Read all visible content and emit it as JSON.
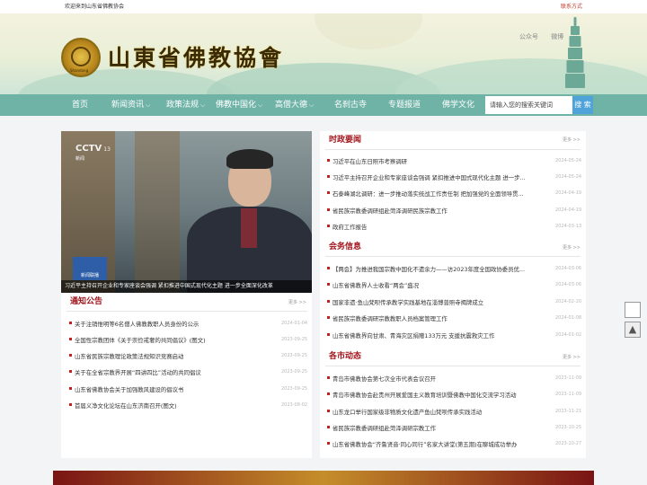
{
  "topbar": {
    "welcome": "欢迎来到山东省佛教协会",
    "contact": "联系方式"
  },
  "header": {
    "title": "山東省佛教協會",
    "logo_text": "Shandong",
    "links": [
      "公众号",
      "微博"
    ]
  },
  "nav": {
    "items": [
      "首页",
      "新闻资讯",
      "政策法规",
      "佛教中国化",
      "高僧大德",
      "名刹古寺",
      "专题报道",
      "佛学文化"
    ],
    "dropdowns": [
      false,
      true,
      true,
      true,
      true,
      false,
      false,
      false
    ]
  },
  "search": {
    "placeholder": "请输入您的搜索关键词",
    "button": "搜 索"
  },
  "slider": {
    "channel": "CCTV",
    "channel_num": "13",
    "channel_sub": "新闻",
    "badge": "新闻联播",
    "caption": "习近平主持召开企业和专家座谈会强调 紧扣推进中国式现代化主题 进一步全面深化改革"
  },
  "notice": {
    "title": "通知公告",
    "more": "更多 >>",
    "items": [
      {
        "text": "关于注销惟明等6名僧人佛教教职人员身份的公示",
        "date": "2024-01-04"
      },
      {
        "text": "全国性宗教团体《关于崇俭戒奢的共同倡议》(图文)",
        "date": "2023-09-25"
      },
      {
        "text": "山东省民族宗教理论政策法规知识竞赛启动",
        "date": "2023-09-25"
      },
      {
        "text": "关于在全省宗教界开展“四讲四比”活动的共同倡议",
        "date": "2023-09-25"
      },
      {
        "text": "山东省佛教协会关于加强教风建设的倡议书",
        "date": "2023-09-25"
      },
      {
        "text": "首届义净文化论坛在山东济南召开(图文)",
        "date": "2023-08-02"
      }
    ]
  },
  "politics": {
    "title": "时政要闻",
    "more": "更多 >>",
    "items": [
      {
        "text": "习近平在山东日照市考察调研",
        "date": "2024-05-24"
      },
      {
        "text": "习近平主持召开企业和专家座谈会强调 紧扣推进中国式现代化主题 进一步...",
        "date": "2024-05-24"
      },
      {
        "text": "石泰峰湖北调研：进一步推动落实统战工作责任制 把加强党的全面领导贯...",
        "date": "2024-04-19"
      },
      {
        "text": "省民族宗教委调研组赴菏泽调研民族宗教工作",
        "date": "2024-04-19"
      },
      {
        "text": "政府工作报告",
        "date": "2024-03-13"
      }
    ]
  },
  "association": {
    "title": "会务信息",
    "more": "更多 >>",
    "items": [
      {
        "text": "【两会】为推进我国宗教中国化不遗余力——访2023年度全国政协委员优...",
        "date": "2024-03-06"
      },
      {
        "text": "山东省佛教界人士收看“两会”盛况",
        "date": "2024-03-06"
      },
      {
        "text": "国家非遗·鱼山梵呗传承教学实践基地在淄博普照寺揭牌成立",
        "date": "2024-02-20"
      },
      {
        "text": "省民族宗教委调研宗教教职人员档案管理工作",
        "date": "2024-01-08"
      },
      {
        "text": "山东省佛教界向甘肃、青海灾区捐赠133万元 支援抗震救灾工作",
        "date": "2024-01-02"
      }
    ]
  },
  "local": {
    "title": "各市动态",
    "more": "更多 >>",
    "items": [
      {
        "text": "青岛市佛教协会第七次全市代表会议召开",
        "date": "2023-11-09"
      },
      {
        "text": "青岛市佛教协会赴贵州开展爱国主义教育培训暨佛教中国化交流学习活动",
        "date": "2023-11-09"
      },
      {
        "text": "山东龙口举行国家级非物质文化遗产鱼山梵呗传承实践活动",
        "date": "2023-11-21"
      },
      {
        "text": "省民族宗教委调研组赴菏泽调研宗教工作",
        "date": "2023-10-25"
      },
      {
        "text": "山东省佛教协会“齐鲁贤音·同心同行”名家大讲堂(第五期)在聊城成功举办",
        "date": "2023-10-27"
      }
    ]
  },
  "colors": {
    "accent": "#a1141c",
    "nav": "#6fb3a7",
    "search_btn": "#4fa3d9"
  }
}
